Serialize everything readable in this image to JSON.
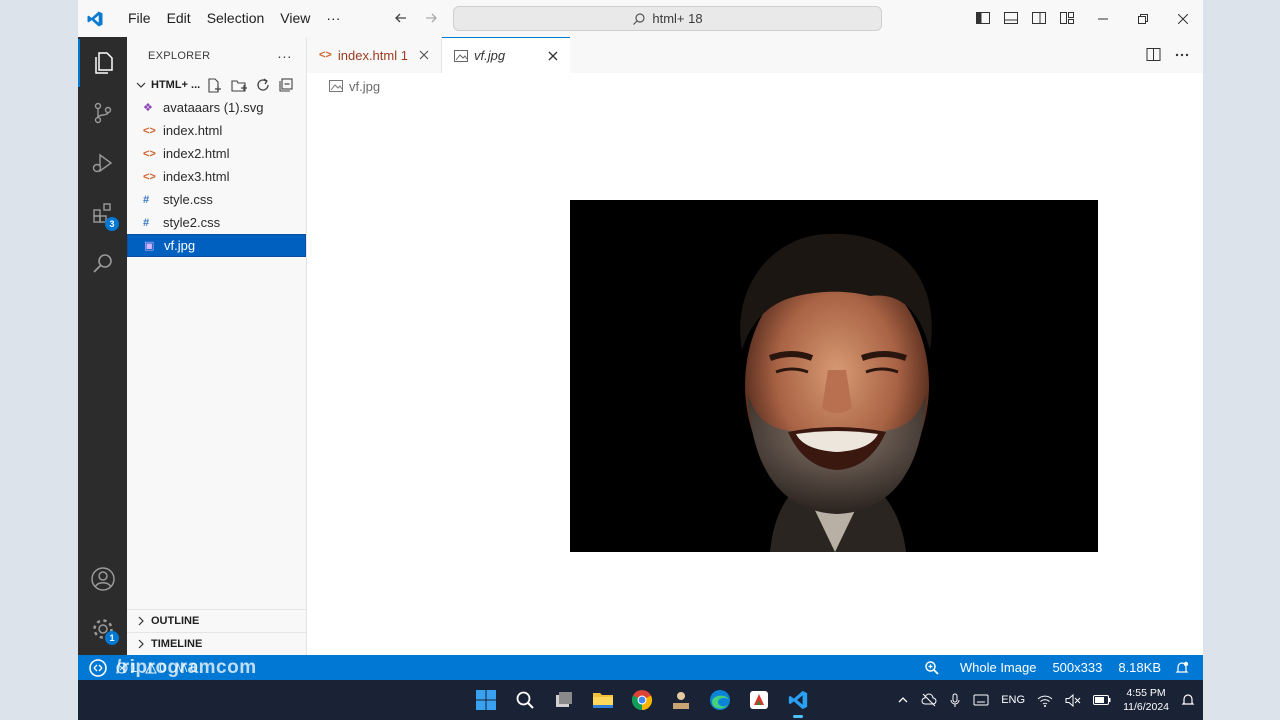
{
  "menu": {
    "file": "File",
    "edit": "Edit",
    "selection": "Selection",
    "view": "View",
    "more": "···"
  },
  "command_center": {
    "text": "html+ 18"
  },
  "activity": {
    "extensions_badge": "3",
    "settings_badge": "1"
  },
  "sidebar": {
    "title": "EXPLORER",
    "more": "···",
    "folder": "HTML+ ...",
    "files": [
      {
        "icon": "svg-file-icon",
        "glyph": "❖",
        "color": "#8a3fb5",
        "name": "avataaars (1).svg"
      },
      {
        "icon": "html-file-icon",
        "glyph": "<>",
        "color": "#d1612d",
        "name": "index.html"
      },
      {
        "icon": "html-file-icon",
        "glyph": "<>",
        "color": "#d1612d",
        "name": "index2.html"
      },
      {
        "icon": "html-file-icon",
        "glyph": "<>",
        "color": "#d1612d",
        "name": "index3.html"
      },
      {
        "icon": "css-file-icon",
        "glyph": "#",
        "color": "#3574c4",
        "name": "style.css"
      },
      {
        "icon": "css-file-icon",
        "glyph": "#",
        "color": "#3574c4",
        "name": "style2.css"
      },
      {
        "icon": "image-file-icon",
        "glyph": "▣",
        "color": "#a069c2",
        "name": "vf.jpg"
      }
    ],
    "outline": "OUTLINE",
    "timeline": "TIMELINE"
  },
  "tabs": [
    {
      "label": "index.html 1",
      "state": "inactive"
    },
    {
      "label": "vf.jpg",
      "state": "active"
    }
  ],
  "breadcrumb": "vf.jpg",
  "statusbar": {
    "watermark": "/riprogramcom",
    "errors": "1",
    "warnings": "0",
    "ports": "0",
    "view_mode": "Whole Image",
    "dimensions": "500x333",
    "file_size": "8.18KB"
  },
  "tray": {
    "language": "ENG",
    "time": "4:55 PM",
    "date": "11/6/2024"
  },
  "colors": {
    "accent": "#0078d4",
    "selection": "#0060c0",
    "statusbar": "#0078d4"
  }
}
